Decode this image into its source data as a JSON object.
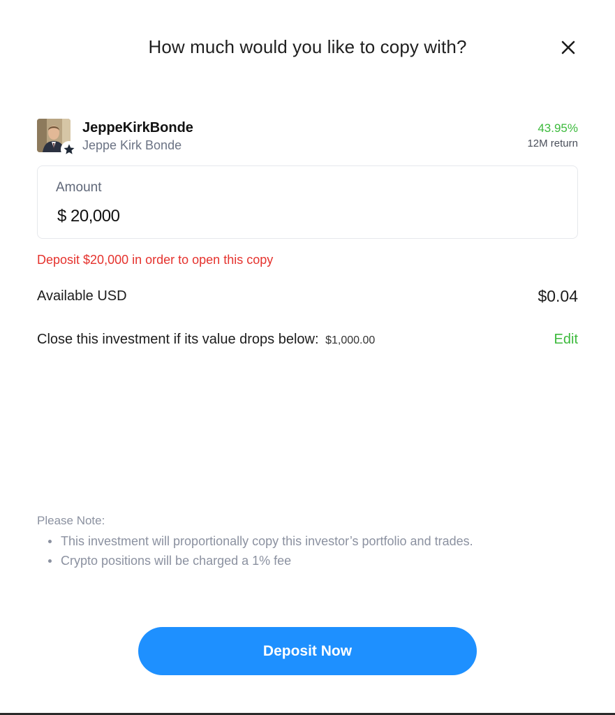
{
  "modal": {
    "title": "How much would you like to copy with?"
  },
  "investor": {
    "username": "JeppeKirkBonde",
    "full_name": "Jeppe Kirk Bonde",
    "return_value": "43.95%",
    "return_label": "12M return",
    "badge_icon": "star-icon"
  },
  "amount": {
    "label": "Amount",
    "value": "$ 20,000"
  },
  "error": {
    "message": "Deposit $20,000 in order to open this copy"
  },
  "available": {
    "label": "Available USD",
    "value": "$0.04"
  },
  "stop_loss": {
    "label": "Close this investment if its value drops below:",
    "value": "$1,000.00",
    "edit_label": "Edit"
  },
  "note": {
    "title": "Please Note:",
    "items": [
      "This investment will proportionally copy this investor’s portfolio and trades.",
      "Crypto positions will be charged a 1% fee"
    ]
  },
  "actions": {
    "deposit_label": "Deposit Now"
  },
  "colors": {
    "accent_blue": "#1e90ff",
    "positive_green": "#3cba3c",
    "error_red": "#e5322d",
    "muted_text": "#8b91a0"
  }
}
